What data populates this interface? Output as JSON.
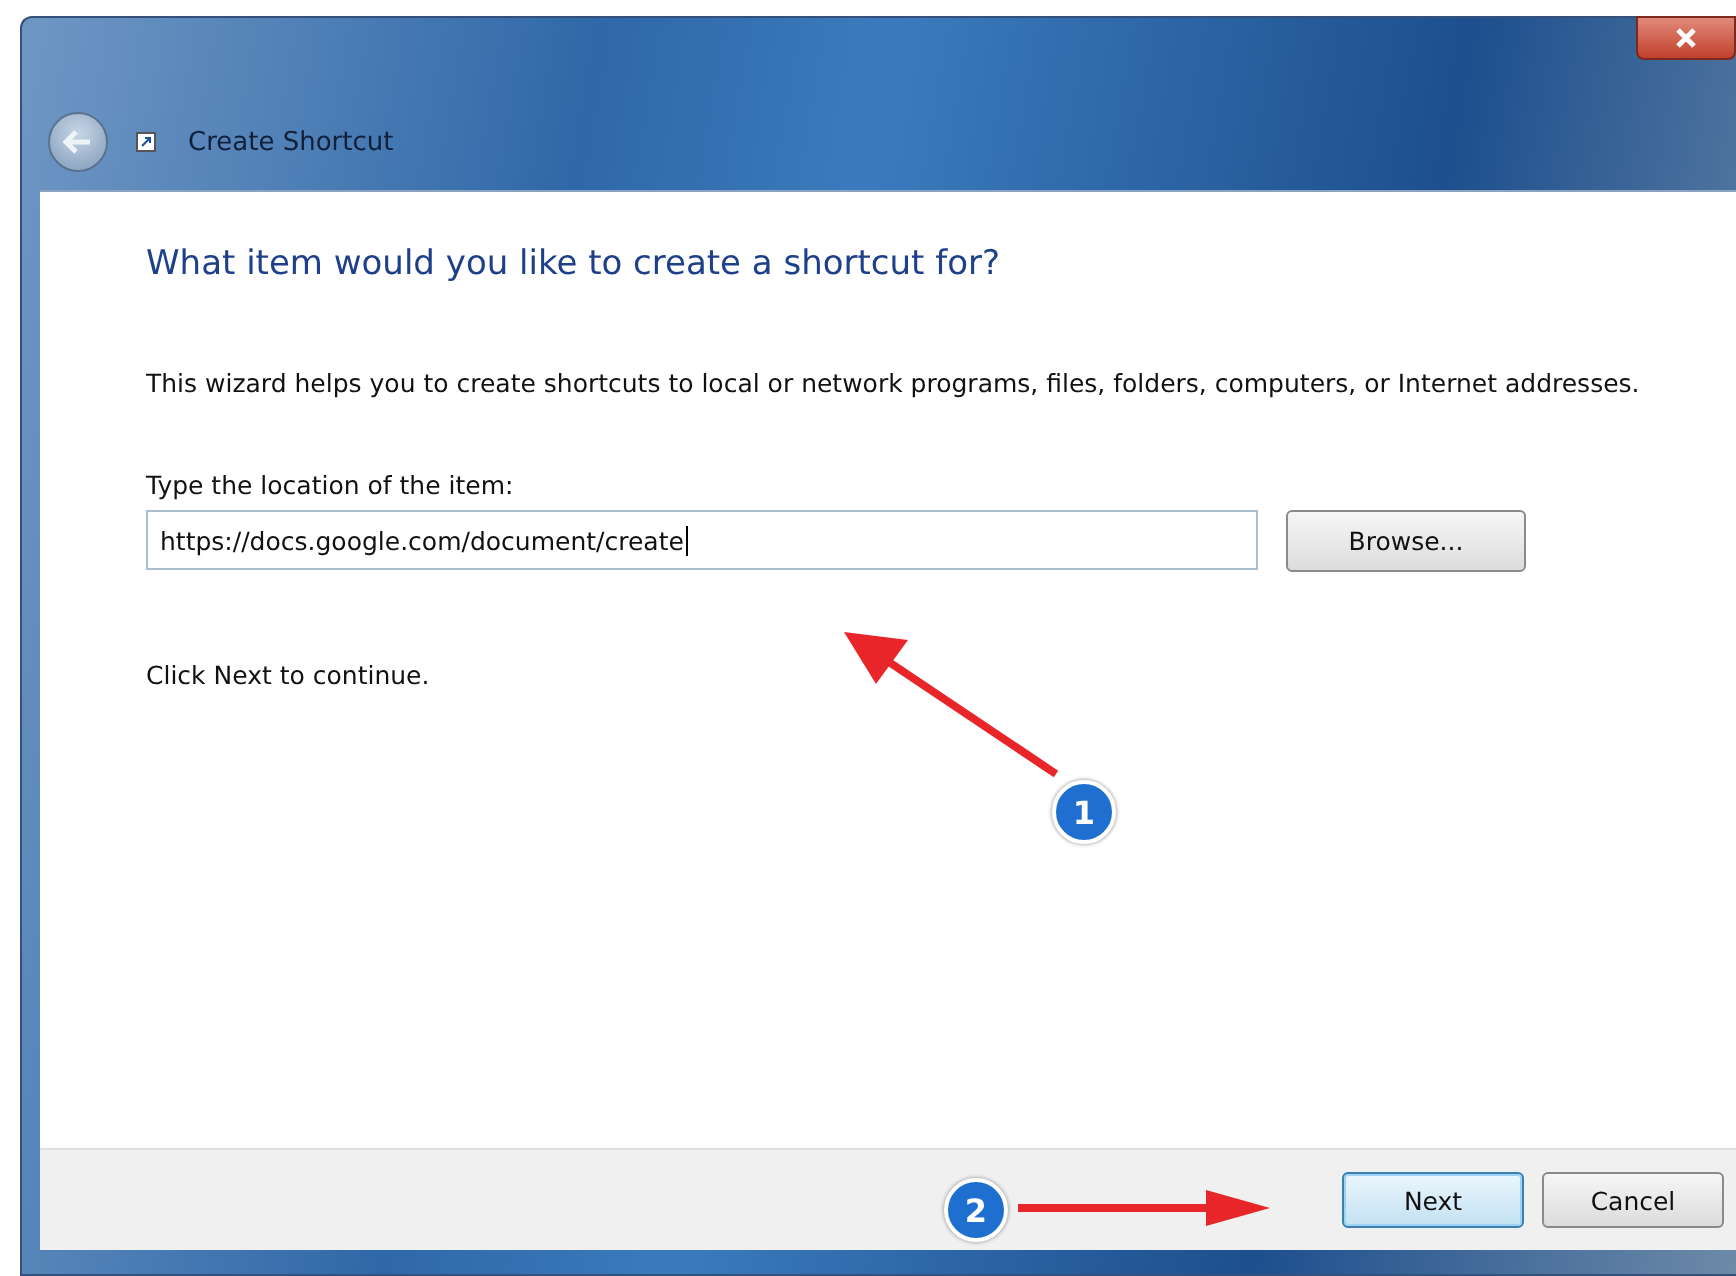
{
  "window": {
    "title": "Create Shortcut"
  },
  "heading": "What item would you like to create a shortcut for?",
  "description": "This wizard helps you to create shortcuts to local or network programs, files, folders, computers, or Internet addresses.",
  "location": {
    "label": "Type the location of the item:",
    "value": "https://docs.google.com/document/create",
    "browse_button": "Browse..."
  },
  "hint": "Click Next to continue.",
  "buttons": [
    {
      "label": "Next",
      "default": true
    },
    {
      "label": "Cancel",
      "default": false
    }
  ],
  "annotations": [
    {
      "label": "1"
    },
    {
      "label": "2"
    }
  ]
}
